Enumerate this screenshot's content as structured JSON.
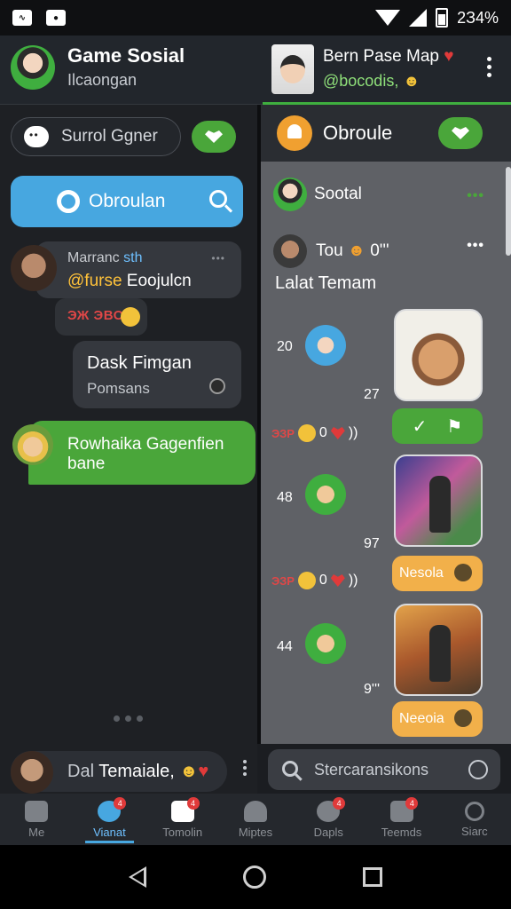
{
  "status_bar": {
    "battery_text": "2З4%"
  },
  "header": {
    "title": "Game Sosial",
    "subtitle": "Ilcaongan",
    "right_title": "Bern Pase Map",
    "right_handle": "@bocodis,"
  },
  "left": {
    "search_pill_label": "Surrol Ggner",
    "blue_search_label": "Obroulan",
    "messages": [
      {
        "line1_prefix": "Marranc ",
        "line1_blue": "sth",
        "line2_at": "@furse",
        "line2_rest": " Eoojulcn",
        "dots": "•••"
      },
      {
        "text": "ЭЖ ЭВО2"
      },
      {
        "line1": "Dask Fimgan",
        "line2": "Pomsans"
      },
      {
        "text": "Rowhaika Gagenfien bane"
      }
    ]
  },
  "right": {
    "header_label": "Obroule",
    "social_label": "Sootal",
    "green_dots": "•••",
    "tou_label": "Tou",
    "tou_suffix": "0'''",
    "white_dots": "•••",
    "latest_label": "Lalat Temam",
    "feed": [
      {
        "num_top": "20",
        "num_bottom": "27"
      },
      {
        "num_top": "48",
        "num_bottom": "97"
      },
      {
        "num_top": "44",
        "num_bottom": "9'''"
      }
    ],
    "emoji_rows": [
      {
        "prefix": "ЭЗР",
        "mid": "0",
        "tail": "))"
      },
      {
        "prefix": "ЭЗР",
        "mid": "0",
        "tail": "))"
      }
    ],
    "buttons": {
      "action2": "Nesola",
      "action3": "Neeoia"
    }
  },
  "compose": {
    "label_dim": "Dal",
    "label_rest": " Temaiale,"
  },
  "bottom_search": {
    "placeholder": "Stercaransikons"
  },
  "tabs": [
    {
      "label": "Me",
      "badge": ""
    },
    {
      "label": "Vianat",
      "badge": "4",
      "active": true
    },
    {
      "label": "Tomolin",
      "badge": "4"
    },
    {
      "label": "Miptes",
      "badge": ""
    },
    {
      "label": "Dapls",
      "badge": "4"
    },
    {
      "label": "Teemds",
      "badge": "4"
    },
    {
      "label": "Siarc",
      "badge": ""
    }
  ],
  "colors": {
    "accent_green": "#4aa63a",
    "accent_blue": "#47a7e0",
    "accent_orange": "#f2b04a"
  }
}
